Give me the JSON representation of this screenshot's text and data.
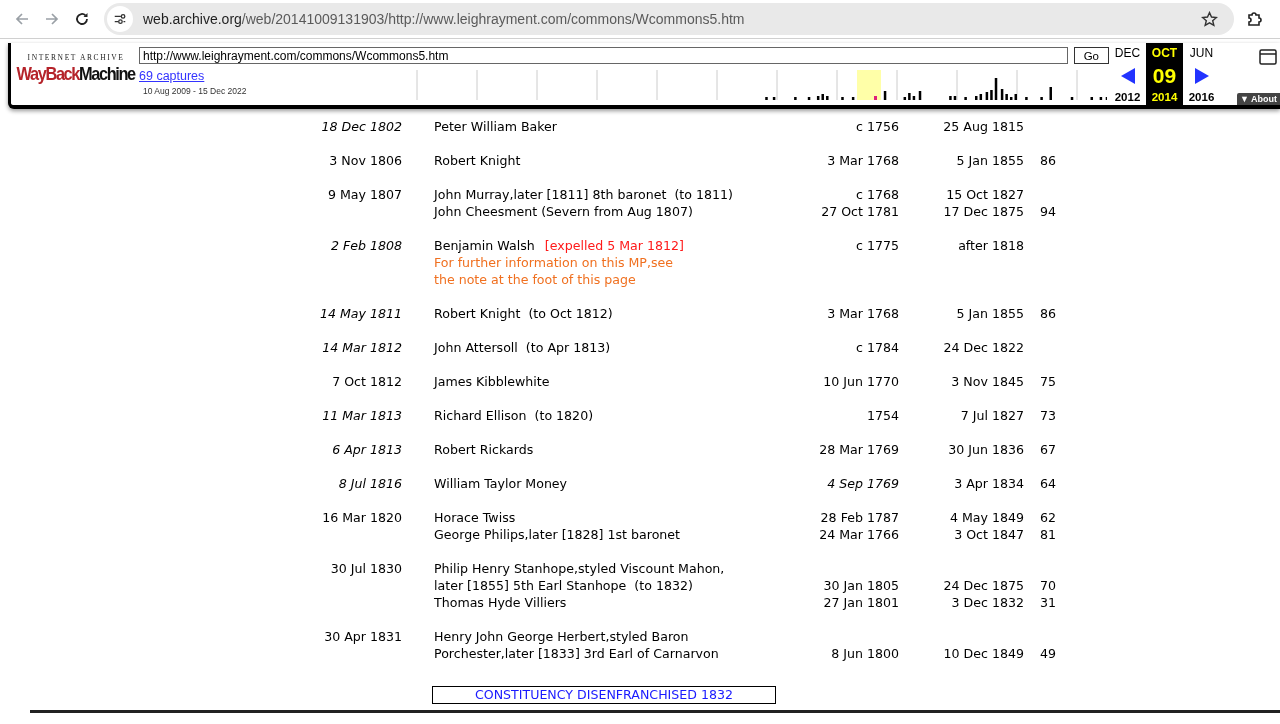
{
  "browser": {
    "url_host": "web.archive.org",
    "url_path": "/web/20141009131903/http://www.leighrayment.com/commons/Wcommons5.htm"
  },
  "wayback": {
    "logo_top": "INTERNET ARCHIVE",
    "logo_word_1": "WayBack",
    "logo_word_2": "Machine",
    "url_value": "http://www.leighrayment.com/commons/Wcommons5.htm",
    "go": "Go",
    "captures": "69 captures",
    "range": "10 Aug 2009 - 15 Dec 2022",
    "months": [
      {
        "month": "DEC",
        "year": "2012",
        "selected": false
      },
      {
        "month": "OCT",
        "day": "09",
        "year": "2014",
        "selected": true
      },
      {
        "month": "JUN",
        "year": "2016",
        "selected": false
      }
    ],
    "about": "▼ About"
  },
  "rows": [
    {
      "date": "18 Dec 1802",
      "date_italic": true,
      "members": [
        {
          "name_lines": [
            "Peter William Baker"
          ],
          "born": "c 1756",
          "born_italic": false,
          "died": "25 Aug 1815"
        }
      ]
    },
    {
      "date": "3 Nov 1806",
      "date_italic": false,
      "members": [
        {
          "name_lines": [
            "Robert Knight"
          ],
          "born": "3 Mar 1768",
          "born_italic": false,
          "died": "5 Jan 1855",
          "age": "86"
        }
      ]
    },
    {
      "date": "9 May 1807",
      "date_italic": false,
      "members": [
        {
          "name_lines": [
            "John Murray,later [1811] 8th baronet  (to 1811)"
          ],
          "born": "c 1768",
          "born_italic": false,
          "died": "15 Oct 1827"
        },
        {
          "name_lines": [
            "John Cheesment (Severn from Aug 1807)"
          ],
          "born": "27 Oct 1781",
          "born_italic": false,
          "died": "17 Dec 1875",
          "age": "94"
        }
      ]
    },
    {
      "date": "2 Feb 1808",
      "date_italic": true,
      "members": [
        {
          "name_lines": [
            "Benjamin Walsh"
          ],
          "remark": "[expelled 5 Mar 1812]",
          "note_lines": [
            "For further information on this MP,see",
            "the note at the foot of this page"
          ],
          "born": "c 1775",
          "born_italic": false,
          "died": "after 1818"
        }
      ]
    },
    {
      "date": "14 May 1811",
      "date_italic": true,
      "members": [
        {
          "name_lines": [
            "Robert Knight  (to Oct 1812)"
          ],
          "born": "3 Mar 1768",
          "born_italic": false,
          "died": "5 Jan 1855",
          "age": "86"
        }
      ]
    },
    {
      "date": "14 Mar 1812",
      "date_italic": true,
      "members": [
        {
          "name_lines": [
            "John Attersoll  (to Apr 1813)"
          ],
          "born": "c 1784",
          "born_italic": false,
          "died": "24 Dec 1822"
        }
      ]
    },
    {
      "date": "7 Oct 1812",
      "date_italic": false,
      "members": [
        {
          "name_lines": [
            "James Kibblewhite"
          ],
          "born": "10 Jun 1770",
          "born_italic": false,
          "died": "3 Nov 1845",
          "age": "75"
        }
      ]
    },
    {
      "date": "11 Mar 1813",
      "date_italic": true,
      "members": [
        {
          "name_lines": [
            "Richard Ellison  (to 1820)"
          ],
          "born": "1754",
          "born_italic": false,
          "died": "7 Jul 1827",
          "age": "73"
        }
      ]
    },
    {
      "date": "6 Apr 1813",
      "date_italic": true,
      "members": [
        {
          "name_lines": [
            "Robert Rickards"
          ],
          "born": "28 Mar 1769",
          "born_italic": false,
          "died": "30 Jun 1836",
          "age": "67"
        }
      ]
    },
    {
      "date": "8 Jul 1816",
      "date_italic": true,
      "members": [
        {
          "name_lines": [
            "William Taylor Money"
          ],
          "born": "4 Sep 1769",
          "born_italic": true,
          "died": "3 Apr 1834",
          "age": "64"
        }
      ]
    },
    {
      "date": "16 Mar 1820",
      "date_italic": false,
      "members": [
        {
          "name_lines": [
            "Horace Twiss"
          ],
          "born": "28 Feb 1787",
          "born_italic": false,
          "died": "4 May 1849",
          "age": "62"
        },
        {
          "name_lines": [
            "George Philips,later [1828] 1st baronet"
          ],
          "born": "24 Mar 1766",
          "born_italic": false,
          "died": "3 Oct 1847",
          "age": "81"
        }
      ]
    },
    {
      "date": "30 Jul 1830",
      "date_italic": false,
      "members": [
        {
          "name_lines": [
            "Philip Henry Stanhope,styled Viscount Mahon,",
            "later [1855] 5th Earl Stanhope  (to 1832)"
          ],
          "born": "30 Jan 1805",
          "born_italic": false,
          "died": "24 Dec 1875",
          "age": "70"
        },
        {
          "name_lines": [
            "Thomas Hyde Villiers"
          ],
          "born": "27 Jan 1801",
          "born_italic": false,
          "died": "3 Dec 1832",
          "age": "31"
        }
      ]
    },
    {
      "date": "30 Apr 1831",
      "date_italic": false,
      "members": [
        {
          "name_lines": [
            "Henry John George Herbert,styled Baron",
            "Porchester,later [1833] 3rd Earl of Carnarvon"
          ],
          "born": "8 Jun 1800",
          "born_italic": false,
          "died": "10 Dec 1849",
          "age": "49"
        }
      ]
    }
  ],
  "footer": "CONSTITUENCY DISENFRANCHISED 1832"
}
